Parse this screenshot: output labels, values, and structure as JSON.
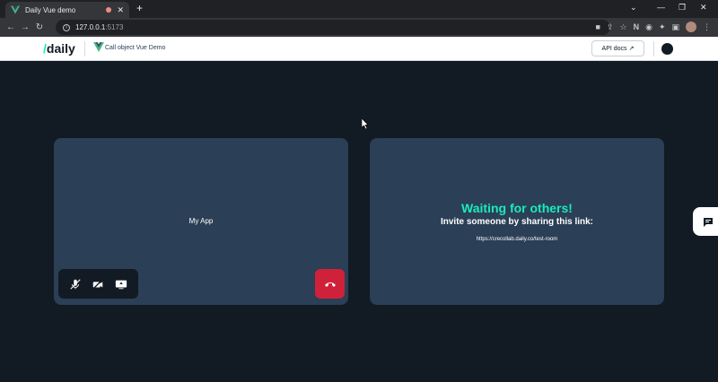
{
  "browser": {
    "tab_title": "Daily Vue demo",
    "tab_close": "✕",
    "new_tab": "+",
    "url_host": "127.0.0.1",
    "url_port": ":5173"
  },
  "header": {
    "logo_slash": "/",
    "logo_text": "daily",
    "demo_title": "Call object Vue Demo",
    "api_docs_label": "API docs"
  },
  "local_tile": {
    "label": "My App"
  },
  "remote_tile": {
    "waiting_title": "Waiting for others!",
    "invite_text": "Invite someone by sharing this link:",
    "share_link": "https://crecollab.daily.co/test-room"
  },
  "colors": {
    "background": "#121a24",
    "tile": "#2b3f56",
    "accent": "#1bebb9",
    "leave": "#d0213a"
  },
  "icons": [
    "vue-logo-icon",
    "record-icon",
    "close-icon",
    "back-icon",
    "forward-icon",
    "reload-icon",
    "info-icon",
    "camera-icon",
    "share-icon",
    "star-icon",
    "notion-icon",
    "color-icon",
    "extensions-icon",
    "sidepanel-icon",
    "avatar-icon",
    "external-link-icon",
    "github-icon",
    "mic-off-icon",
    "camera-off-icon",
    "screenshare-icon",
    "hangup-icon",
    "chat-icon"
  ]
}
